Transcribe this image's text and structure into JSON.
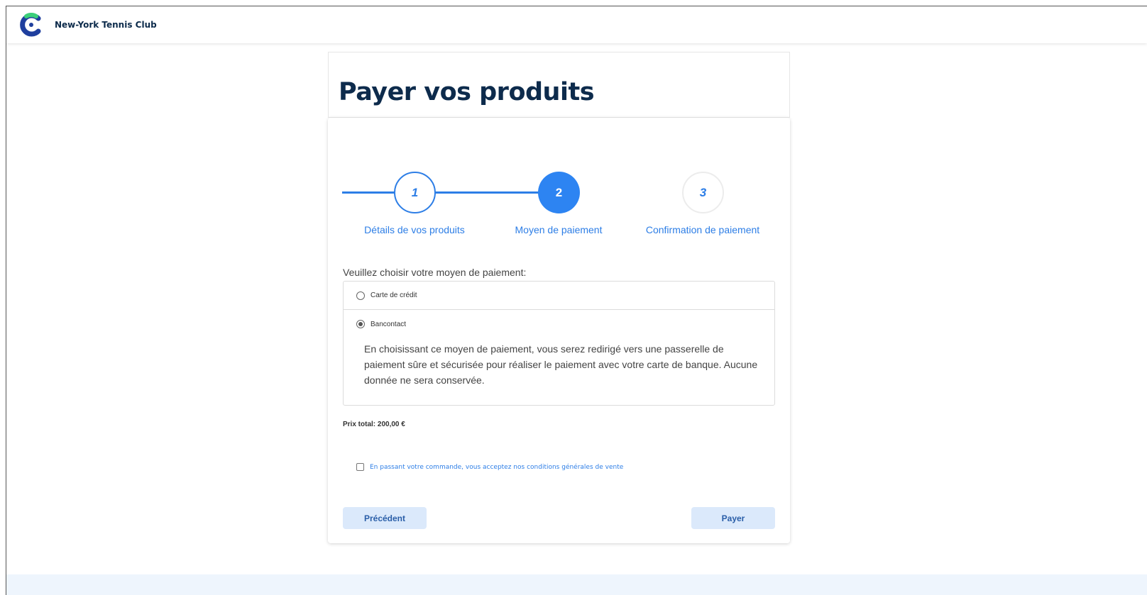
{
  "header": {
    "club_name": "New-York Tennis Club",
    "logo_icon": "club-logo-icon"
  },
  "page": {
    "title": "Payer vos produits"
  },
  "stepper": {
    "steps": [
      {
        "number": "1",
        "label": "Détails de vos produits",
        "state": "done"
      },
      {
        "number": "2",
        "label": "Moyen de paiement",
        "state": "active"
      },
      {
        "number": "3",
        "label": "Confirmation de paiement",
        "state": "todo"
      }
    ]
  },
  "payment": {
    "prompt": "Veuillez choisir votre moyen de paiement:",
    "options": [
      {
        "label": "Carte de crédit",
        "selected": false
      },
      {
        "label": "Bancontact",
        "selected": true
      }
    ],
    "description": "En choisissant ce moyen de paiement, vous serez redirigé vers une passerelle de paiement sûre et sécurisée pour réaliser le paiement avec votre carte de banque. Aucune donnée ne sera conservée."
  },
  "summary": {
    "total": "Prix total: 200,00 €"
  },
  "terms": {
    "label": "En passant votre commande, vous acceptez nos conditions générales de vente",
    "checked": false
  },
  "actions": {
    "previous_label": "Précédent",
    "pay_label": "Payer"
  },
  "colors": {
    "accent": "#2d7ee6",
    "title": "#0d2b4c",
    "button_bg": "#dbe9fb"
  }
}
